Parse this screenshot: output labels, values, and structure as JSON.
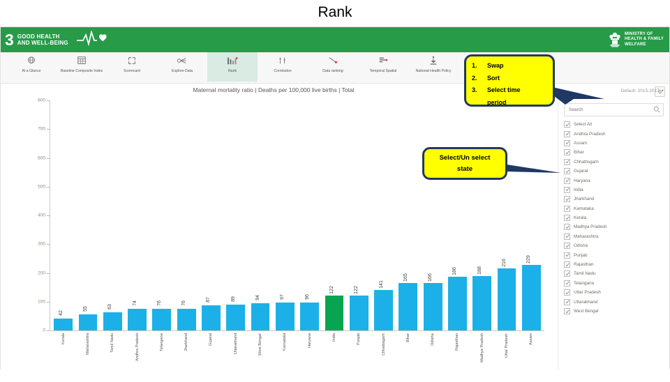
{
  "slide": {
    "title": "Rank"
  },
  "banner": {
    "sdg_number": "3",
    "sdg_line1": "GOOD HEALTH",
    "sdg_line2": "AND WELL-BEING",
    "ministry_line1": "MINISTRY OF",
    "ministry_line2": "HEALTH & FAMILY",
    "ministry_line3": "WELFARE"
  },
  "toolbar": {
    "items": [
      {
        "label": "At a Glance",
        "icon": "globe-icon",
        "active": false
      },
      {
        "label": "Baseline Composite Index",
        "icon": "table-icon",
        "active": false
      },
      {
        "label": "Scorecard",
        "icon": "scorecard-icon",
        "active": false
      },
      {
        "label": "Explore Data",
        "icon": "explore-data-icon",
        "active": false
      },
      {
        "label": "Rank",
        "icon": "bar-chart-icon",
        "active": true
      },
      {
        "label": "Correlation",
        "icon": "correlation-icon",
        "active": false
      },
      {
        "label": "Data ranking",
        "icon": "data-ranking-icon",
        "active": false
      },
      {
        "label": "Temporal Spatial",
        "icon": "temporal-icon",
        "active": false
      },
      {
        "label": "National Health Policy",
        "icon": "policy-icon",
        "active": false
      }
    ]
  },
  "chart_panel": {
    "corner_button_label": "⚙",
    "time_period": "Default: 2015-2017",
    "time_period_caret": "▾"
  },
  "state_panel": {
    "search_placeholder": "Search",
    "search_value": "",
    "search_icon": "search-icon",
    "items": [
      {
        "label": "Select All",
        "checked": true
      },
      {
        "label": "Andhra Pradesh",
        "checked": true
      },
      {
        "label": "Assam",
        "checked": true
      },
      {
        "label": "Bihar",
        "checked": true
      },
      {
        "label": "Chhattisgarh",
        "checked": true
      },
      {
        "label": "Gujarat",
        "checked": true
      },
      {
        "label": "Haryana",
        "checked": true
      },
      {
        "label": "India",
        "checked": true
      },
      {
        "label": "Jharkhand",
        "checked": true
      },
      {
        "label": "Karnataka",
        "checked": true
      },
      {
        "label": "Kerala",
        "checked": true
      },
      {
        "label": "Madhya Pradesh",
        "checked": true
      },
      {
        "label": "Maharashtra",
        "checked": true
      },
      {
        "label": "Odisha",
        "checked": true
      },
      {
        "label": "Punjab",
        "checked": true
      },
      {
        "label": "Rajasthan",
        "checked": true
      },
      {
        "label": "Tamil Nadu",
        "checked": true
      },
      {
        "label": "Telangana",
        "checked": true
      },
      {
        "label": "Uttar Pradesh",
        "checked": true
      },
      {
        "label": "Uttarakhand",
        "checked": true
      },
      {
        "label": "West Bengal",
        "checked": true
      }
    ]
  },
  "callouts": {
    "actions": {
      "rows": [
        {
          "num": "1.",
          "text": "Swap"
        },
        {
          "num": "2.",
          "text": "Sort"
        },
        {
          "num": "3.",
          "text": "Select time"
        },
        {
          "num": "",
          "text": "period"
        }
      ]
    },
    "select_state": {
      "text": "Select/Un select\nstate"
    }
  },
  "chart_data": {
    "type": "bar",
    "title": "Maternal mortality ratio | Deaths per 100,000 live births | Total",
    "xlabel": "",
    "ylabel": "",
    "ylim": [
      0,
      800
    ],
    "yticks": [
      0,
      100,
      200,
      300,
      400,
      500,
      600,
      700,
      800
    ],
    "grid": false,
    "legend": "none",
    "bar_color": "#1cb0e8",
    "highlight_color": "#09a451",
    "highlight_category": "India",
    "categories": [
      "Kerala",
      "Maharashtra",
      "Tamil Nadu",
      "Andhra Pradesh",
      "Telangana",
      "Jharkhand",
      "Gujarat",
      "Uttarakhand",
      "West Bengal",
      "Karnataka",
      "Haryana",
      "India",
      "Punjab",
      "Chhattisgarh",
      "Bihar",
      "Odisha",
      "Rajasthan",
      "Madhya Pradesh",
      "Uttar Pradesh",
      "Assam"
    ],
    "values": [
      42,
      55,
      63,
      74,
      76,
      76,
      87,
      89,
      94,
      97,
      96,
      122,
      122,
      141,
      165,
      166,
      186,
      188,
      216,
      229
    ]
  }
}
